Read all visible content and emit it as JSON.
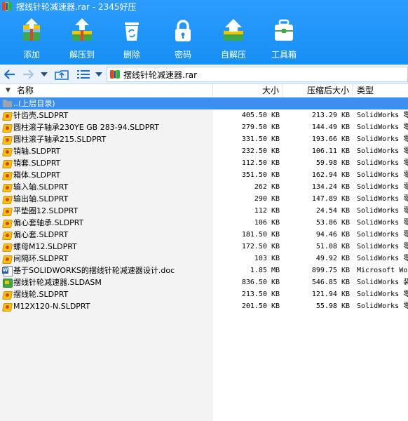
{
  "window": {
    "title": "摆线针轮减速器.rar - 2345好压"
  },
  "toolbar": {
    "buttons": [
      {
        "label": "添加",
        "icon": "add-archive-icon"
      },
      {
        "label": "解压到",
        "icon": "extract-to-icon"
      },
      {
        "label": "删除",
        "icon": "recycle-bin-icon"
      },
      {
        "label": "密码",
        "icon": "lock-icon"
      },
      {
        "label": "自解压",
        "icon": "self-extract-icon"
      },
      {
        "label": "工具箱",
        "icon": "toolbox-icon"
      }
    ]
  },
  "navbar": {
    "address": "摆线针轮减速器.rar",
    "icons": [
      "back-arrow-icon",
      "forward-arrow-icon",
      "history-dropdown-icon",
      "up-folder-icon",
      "view-list-icon",
      "view-dropdown-icon"
    ]
  },
  "columns": {
    "name": "名称",
    "size": "大小",
    "compressed": "压缩后大小",
    "type": "类型"
  },
  "colors": {
    "toolbar_blue": "#1e90ff",
    "selected_row": "#3b8ff0"
  },
  "files": [
    {
      "name": "..(上层目录)",
      "size": "",
      "compressed": "",
      "type": "",
      "icon": "folder-up-icon",
      "selected": true
    },
    {
      "name": "针齿壳.SLDPRT",
      "size": "405.50 KB",
      "compressed": "213.29 KB",
      "type": "SolidWorks 零",
      "icon": "solidworks-part-icon"
    },
    {
      "name": "圆柱滚子轴承230YE GB 283-94.SLDPRT",
      "size": "279.50 KB",
      "compressed": "144.49 KB",
      "type": "SolidWorks 零",
      "icon": "solidworks-part-icon"
    },
    {
      "name": "圆柱滚子轴承215.SLDPRT",
      "size": "331.50 KB",
      "compressed": "193.66 KB",
      "type": "SolidWorks 零",
      "icon": "solidworks-part-icon"
    },
    {
      "name": "销轴.SLDPRT",
      "size": "232.50 KB",
      "compressed": "106.11 KB",
      "type": "SolidWorks 零",
      "icon": "solidworks-part-icon"
    },
    {
      "name": "销套.SLDPRT",
      "size": "112.50 KB",
      "compressed": "59.98 KB",
      "type": "SolidWorks 零",
      "icon": "solidworks-part-icon"
    },
    {
      "name": "箱体.SLDPRT",
      "size": "351.50 KB",
      "compressed": "162.94 KB",
      "type": "SolidWorks 零",
      "icon": "solidworks-part-icon"
    },
    {
      "name": "输入轴.SLDPRT",
      "size": "262 KB",
      "compressed": "134.24 KB",
      "type": "SolidWorks 零",
      "icon": "solidworks-part-icon"
    },
    {
      "name": "输出轴.SLDPRT",
      "size": "290 KB",
      "compressed": "147.89 KB",
      "type": "SolidWorks 零",
      "icon": "solidworks-part-icon"
    },
    {
      "name": "平垫圈12.SLDPRT",
      "size": "112 KB",
      "compressed": "24.54 KB",
      "type": "SolidWorks 零",
      "icon": "solidworks-part-icon"
    },
    {
      "name": "偏心套轴承.SLDPRT",
      "size": "106 KB",
      "compressed": "53.86 KB",
      "type": "SolidWorks 零",
      "icon": "solidworks-part-icon"
    },
    {
      "name": "偏心套.SLDPRT",
      "size": "181.50 KB",
      "compressed": "94.46 KB",
      "type": "SolidWorks 零",
      "icon": "solidworks-part-icon"
    },
    {
      "name": "螺母M12.SLDPRT",
      "size": "172.50 KB",
      "compressed": "51.08 KB",
      "type": "SolidWorks 零",
      "icon": "solidworks-part-icon"
    },
    {
      "name": "间隔环.SLDPRT",
      "size": "103 KB",
      "compressed": "49.92 KB",
      "type": "SolidWorks 零",
      "icon": "solidworks-part-icon"
    },
    {
      "name": "基于SOLIDWORKS的摆线针轮减速器设计.doc",
      "size": "1.85 MB",
      "compressed": "899.75 KB",
      "type": "Microsoft Wo",
      "icon": "word-document-icon"
    },
    {
      "name": "摆线针轮减速器.SLDASM",
      "size": "836.50 KB",
      "compressed": "546.85 KB",
      "type": "SolidWorks 装",
      "icon": "solidworks-assembly-icon"
    },
    {
      "name": "摆线轮.SLDPRT",
      "size": "213.50 KB",
      "compressed": "121.94 KB",
      "type": "SolidWorks 零",
      "icon": "solidworks-part-icon"
    },
    {
      "name": "M12X120-N.SLDPRT",
      "size": "201.50 KB",
      "compressed": "55.98 KB",
      "type": "SolidWorks 零",
      "icon": "solidworks-part-icon"
    }
  ]
}
